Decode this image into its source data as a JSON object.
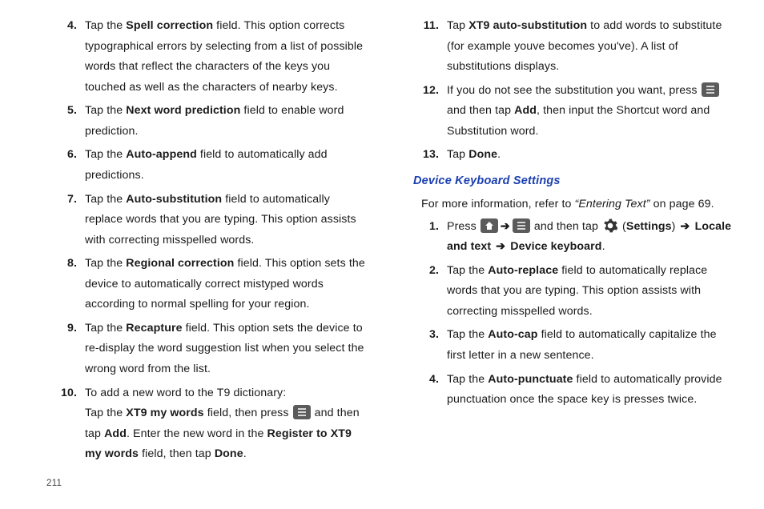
{
  "left": {
    "items": [
      {
        "n": "4.",
        "pre": "Tap the ",
        "bold": "Spell correction",
        "post": " field. This option corrects typographical errors by selecting from a list of possible words that reflect the characters of the keys you touched as well as the characters of nearby keys."
      },
      {
        "n": "5.",
        "pre": "Tap the ",
        "bold": "Next word prediction",
        "post": " field to enable word prediction."
      },
      {
        "n": "6.",
        "pre": "Tap the ",
        "bold": "Auto-append",
        "post": " field to automatically add predictions."
      },
      {
        "n": "7.",
        "pre": "Tap the ",
        "bold": "Auto-substitution",
        "post": " field to automatically replace words that you are typing. This option assists with correcting misspelled words."
      },
      {
        "n": "8.",
        "pre": "Tap the ",
        "bold": "Regional correction",
        "post": " field. This option sets the device to automatically correct mistyped words according to normal spelling for your region."
      },
      {
        "n": "9.",
        "pre": "Tap the ",
        "bold": "Recapture",
        "post": " field. This option sets the device to re-display the word suggestion list when you select the wrong word from the list."
      }
    ],
    "item10": {
      "n": "10.",
      "line1": "To add a new word to the T9 dictionary:",
      "line2_pre": "Tap the ",
      "line2_b1": "XT9 my words",
      "line2_mid": " field, then press ",
      "line2_post": " and then tap ",
      "line2_b2": "Add",
      "line2_post2": ". Enter the new word in the ",
      "line2_b3": "Register to XT9 my words",
      "line2_post3": " field, then tap ",
      "line2_b4": "Done",
      "line2_end": "."
    }
  },
  "right": {
    "item11": {
      "n": "11.",
      "pre": "Tap ",
      "bold": "XT9 auto-substitution",
      "post": " to add words to substitute (for example youve becomes you've). A list of substitutions displays."
    },
    "item12": {
      "n": "12.",
      "pre": "If you do not see the substitution you want, press ",
      "post": " and then tap ",
      "b2": "Add",
      "post2": ", then input the Shortcut word and Substitution word."
    },
    "item13": {
      "n": "13.",
      "pre": "Tap ",
      "bold": "Done",
      "post": "."
    },
    "heading": "Device Keyboard Settings",
    "subline_pre": "For more information, refer to ",
    "subline_ital": "“Entering Text” ",
    "subline_post": " on page 69.",
    "r1": {
      "n": "1.",
      "press": "Press ",
      "and_then_tap": " and then tap ",
      "settings_open": " (",
      "settings": "Settings",
      "settings_close": ") ",
      "b1": "Locale and text ",
      "b2": " Device keyboard",
      "end": "."
    },
    "r2": {
      "n": "2.",
      "pre": "Tap the ",
      "bold": "Auto-replace",
      "post": " field to automatically replace words that you are typing. This option assists with correcting misspelled words."
    },
    "r3": {
      "n": "3.",
      "pre": "Tap the ",
      "bold": "Auto-cap",
      "post": " field to automatically capitalize the first letter in a new sentence."
    },
    "r4": {
      "n": "4.",
      "pre": "Tap the ",
      "bold": "Auto-punctuate",
      "post": " field to automatically provide punctuation once the space key is presses twice."
    }
  },
  "arrow": "➔",
  "page_number": "211"
}
